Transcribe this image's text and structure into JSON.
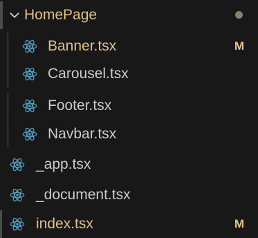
{
  "explorer": {
    "folder": {
      "name": "HomePage",
      "expanded": true,
      "decoration": "modified-dot",
      "items": [
        {
          "name": "Banner.tsx",
          "status": "M",
          "icon": "react-icon"
        },
        {
          "name": "Carousel.tsx",
          "status": "",
          "icon": "react-icon"
        },
        {
          "name": "Footer.tsx",
          "status": "",
          "icon": "react-icon"
        },
        {
          "name": "Navbar.tsx",
          "status": "",
          "icon": "react-icon"
        }
      ]
    },
    "files": [
      {
        "name": "_app.tsx",
        "status": "",
        "icon": "react-icon"
      },
      {
        "name": "_document.tsx",
        "status": "",
        "icon": "react-icon"
      },
      {
        "name": "index.tsx",
        "status": "M",
        "icon": "react-icon"
      }
    ],
    "colors": {
      "background": "#181818",
      "selected_row": "#37373d",
      "modified": "#e2c08d",
      "react_icon": "#519aba",
      "text": "#cccccc"
    }
  }
}
